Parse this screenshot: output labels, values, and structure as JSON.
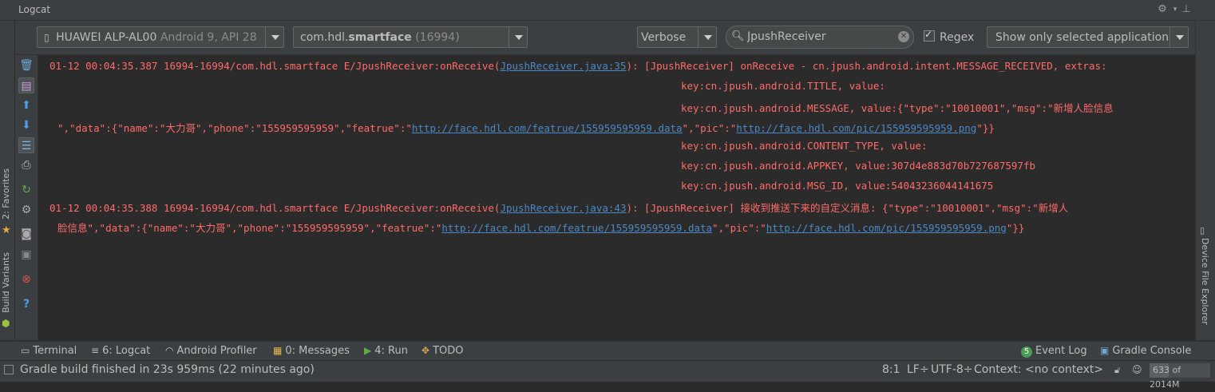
{
  "panel": {
    "title": "Logcat"
  },
  "toolbar": {
    "device_name": "HUAWEI ALP-AL00",
    "device_detail": "Android 9, API 28",
    "process_prefix": "com.hdl.",
    "process_bold": "smartface",
    "process_pid": "(16994)",
    "level": "Verbose",
    "search_value": "JpushReceiver",
    "regex_label": "Regex",
    "regex_checked": true,
    "filter": "Show only selected application"
  },
  "left_tabs": {
    "favorites": "2: Favorites",
    "build_variants": "Build Variants"
  },
  "right_tabs": {
    "device_file_explorer": "Device File Explorer"
  },
  "log": {
    "entry1": {
      "head": "01-12 00:04:35.387 16994-16994/com.hdl.smartface E/JpushReceiver:onReceive(",
      "link": "JpushReceiver.java:35",
      "tail": "): [JpushReceiver] onReceive - cn.jpush.android.intent.MESSAGE_RECEIVED, extras:",
      "l2": "key:cn.jpush.android.TITLE, value:",
      "l3": "key:cn.jpush.android.MESSAGE, value:{\"type\":\"10010001\",\"msg\":\"新增人脸信息",
      "l4a": "\",\"data\":{\"name\":\"大力哥\",\"phone\":\"155959595959\",\"featrue\":\"",
      "l4link1": "http://face.hdl.com/featrue/155959595959.data",
      "l4b": "\",\"pic\":\"",
      "l4link2": "http://face.hdl.com/pic/155959595959.png",
      "l4c": "\"}}",
      "l5": "key:cn.jpush.android.CONTENT_TYPE, value:",
      "l6": "key:cn.jpush.android.APPKEY, value:307d4e883d70b727687597fb",
      "l7": "key:cn.jpush.android.MSG_ID, value:54043236044141675"
    },
    "entry2": {
      "head": "01-12 00:04:35.388 16994-16994/com.hdl.smartface E/JpushReceiver:onReceive(",
      "link": "JpushReceiver.java:43",
      "tail": "): [JpushReceiver] 接收到推送下来的自定义消息: {\"type\":\"10010001\",\"msg\":\"新增人",
      "l2a": "脸信息\",\"data\":{\"name\":\"大力哥\",\"phone\":\"155959595959\",\"featrue\":\"",
      "l2link1": "http://face.hdl.com/featrue/155959595959.data",
      "l2b": "\",\"pic\":\"",
      "l2link2": "http://face.hdl.com/pic/155959595959.png",
      "l2c": "\"}}"
    }
  },
  "bottom_tabs": {
    "terminal": "Terminal",
    "logcat": "6: Logcat",
    "profiler": "Android Profiler",
    "messages": "0: Messages",
    "run": "4: Run",
    "todo": "TODO",
    "event_log_badge": "5",
    "event_log": "Event Log",
    "gradle_console": "Gradle Console"
  },
  "status": {
    "message": "Gradle build finished in 23s 959ms (22 minutes ago)",
    "position": "8:1",
    "line_sep": "LF÷",
    "encoding": "UTF-8÷",
    "context": "Context: <no context>",
    "memory_used": "633",
    "memory_of": "of",
    "memory_total": "2014M",
    "memory_fraction": 0.31
  },
  "colors": {
    "error_text": "#ff6b68",
    "link": "#4a88c7",
    "background": "#2b2b2b",
    "chrome": "#3c3f41"
  },
  "icons": [
    "gear-icon",
    "minimize-icon",
    "phone-icon",
    "search-icon",
    "clear-icon",
    "trash-icon",
    "soft-wrap-icon",
    "arrow-up-icon",
    "arrow-down-icon",
    "format-icon",
    "print-icon",
    "restart-icon",
    "settings-icon",
    "camera-icon",
    "record-icon",
    "stop-icon",
    "help-icon",
    "star-icon",
    "android-icon",
    "terminal-icon",
    "logcat-icon",
    "profiler-icon",
    "messages-icon",
    "run-icon",
    "todo-icon",
    "event-log-icon",
    "gradle-icon",
    "lock-icon",
    "inspector-icon"
  ]
}
